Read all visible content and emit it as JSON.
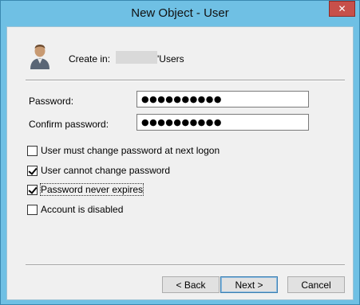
{
  "window": {
    "title": "New Object - User",
    "close_label": "✕"
  },
  "header": {
    "create_in_label": "Create in:",
    "create_in_path": "'Users"
  },
  "fields": {
    "password_label": "Password:",
    "password_value": "●●●●●●●●●●",
    "confirm_label": "Confirm password:",
    "confirm_value": "●●●●●●●●●●"
  },
  "options": [
    {
      "label": "User must change password at next logon",
      "checked": false
    },
    {
      "label": "User cannot change password",
      "checked": true
    },
    {
      "label": "Password never expires",
      "checked": true
    },
    {
      "label": "Account is disabled",
      "checked": false
    }
  ],
  "buttons": {
    "back": "< Back",
    "next": "Next >",
    "cancel": "Cancel"
  },
  "icons": {
    "user": "user-icon",
    "close": "close-icon"
  }
}
